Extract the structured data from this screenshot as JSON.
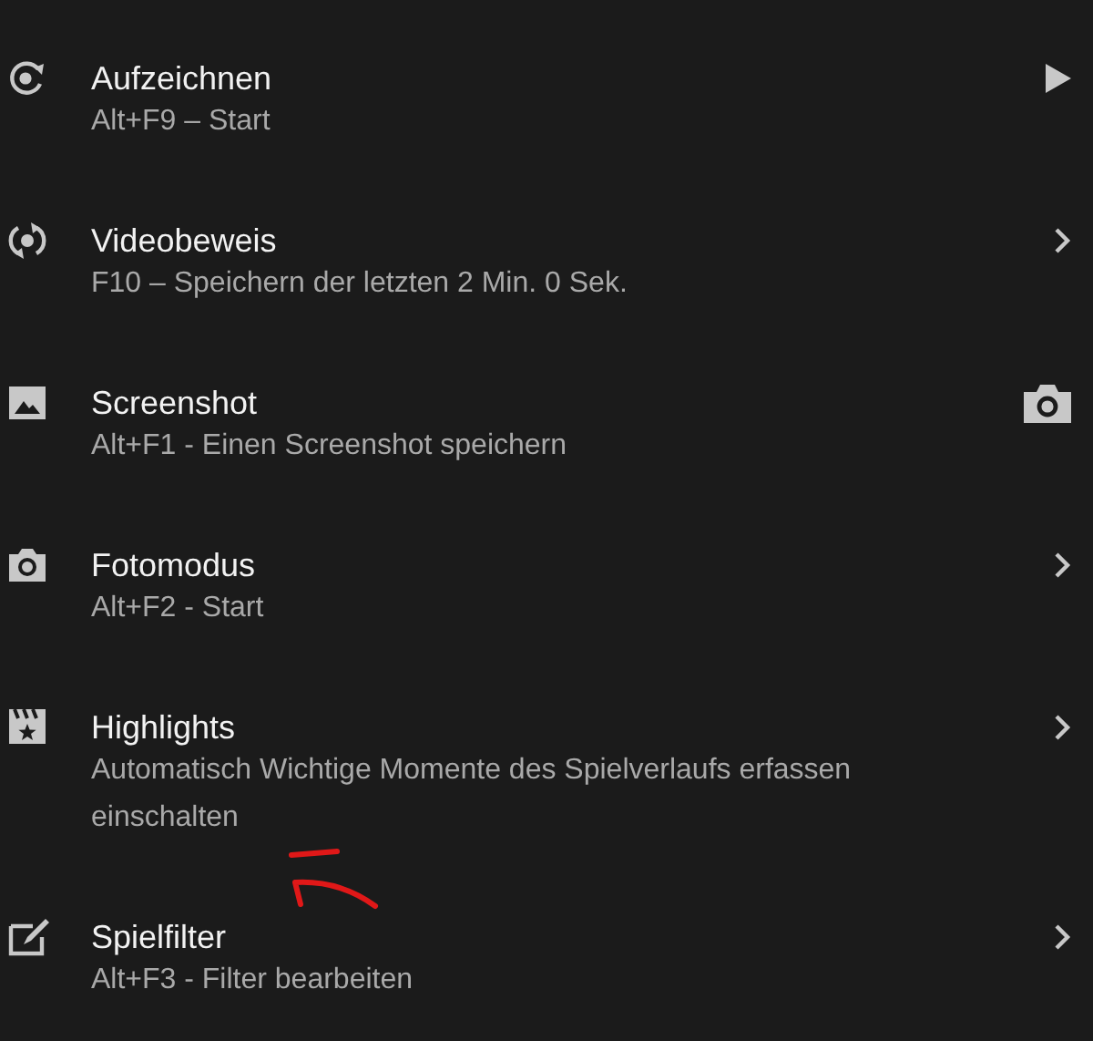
{
  "items": [
    {
      "title": "Aufzeichnen",
      "subtitle": "Alt+F9 – Start"
    },
    {
      "title": "Videobeweis",
      "subtitle": "F10 – Speichern der letzten 2 Min. 0 Sek."
    },
    {
      "title": "Screenshot",
      "subtitle": "Alt+F1 - Einen Screenshot speichern"
    },
    {
      "title": "Fotomodus",
      "subtitle": "Alt+F2 - Start"
    },
    {
      "title": "Highlights",
      "subtitle": "Automatisch Wichtige Momente des Spielverlaufs erfassen einschalten"
    },
    {
      "title": "Spielfilter",
      "subtitle": "Alt+F3 - Filter bearbeiten"
    }
  ]
}
